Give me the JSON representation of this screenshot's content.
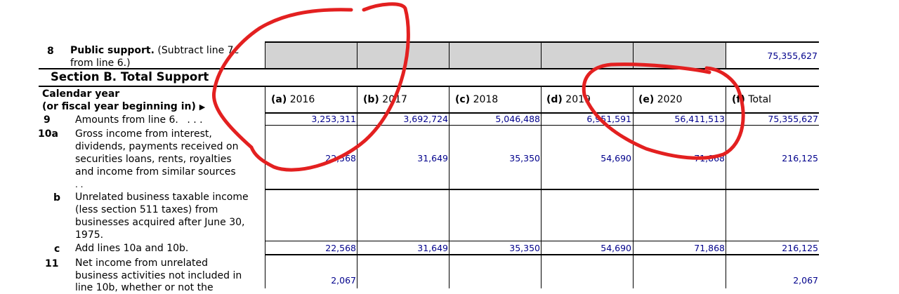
{
  "line8": {
    "num": "8",
    "title": "Public support.",
    "desc1": "(Subtract line 7c",
    "desc2": "from line 6.)",
    "total": "75,355,627"
  },
  "sectionB": {
    "title": "Section B. Total Support"
  },
  "calendar": {
    "line1": "Calendar year",
    "line2": "(or fiscal year beginning in)",
    "arrow": "▶"
  },
  "columns": [
    {
      "id": "(a)",
      "year": "2016"
    },
    {
      "id": "(b)",
      "year": "2017"
    },
    {
      "id": "(c)",
      "year": "2018"
    },
    {
      "id": "(d)",
      "year": "2019"
    },
    {
      "id": "(e)",
      "year": "2020"
    },
    {
      "id": "(f)",
      "year": "Total"
    }
  ],
  "line9": {
    "num": "9",
    "desc": "Amounts from line 6.",
    "dots": ". . .",
    "values": [
      "3,253,311",
      "3,692,724",
      "5,046,488",
      "6,951,591",
      "56,411,513",
      "75,355,627"
    ]
  },
  "line10a": {
    "num": "10a",
    "desc": [
      "Gross income from interest,",
      "dividends, payments received on",
      "securities loans, rents, royalties",
      "and income from similar sources",
      ". ."
    ],
    "values": [
      "22,568",
      "31,649",
      "35,350",
      "54,690",
      "71,868",
      "216,125"
    ]
  },
  "line10b": {
    "num": "b",
    "desc": [
      "Unrelated business taxable income",
      "(less section 511 taxes) from",
      "businesses acquired after June 30,",
      "1975."
    ]
  },
  "line10c": {
    "num": "c",
    "desc": "Add lines 10a and 10b.",
    "values": [
      "22,568",
      "31,649",
      "35,350",
      "54,690",
      "71,868",
      "216,125"
    ]
  },
  "line11": {
    "num": "11",
    "desc": [
      "Net income from unrelated",
      "business activities not included in",
      "line 10b, whether or not the"
    ],
    "values": [
      "2,067",
      "",
      "",
      "",
      "",
      "2,067"
    ]
  },
  "annotation_color": "#e32020"
}
